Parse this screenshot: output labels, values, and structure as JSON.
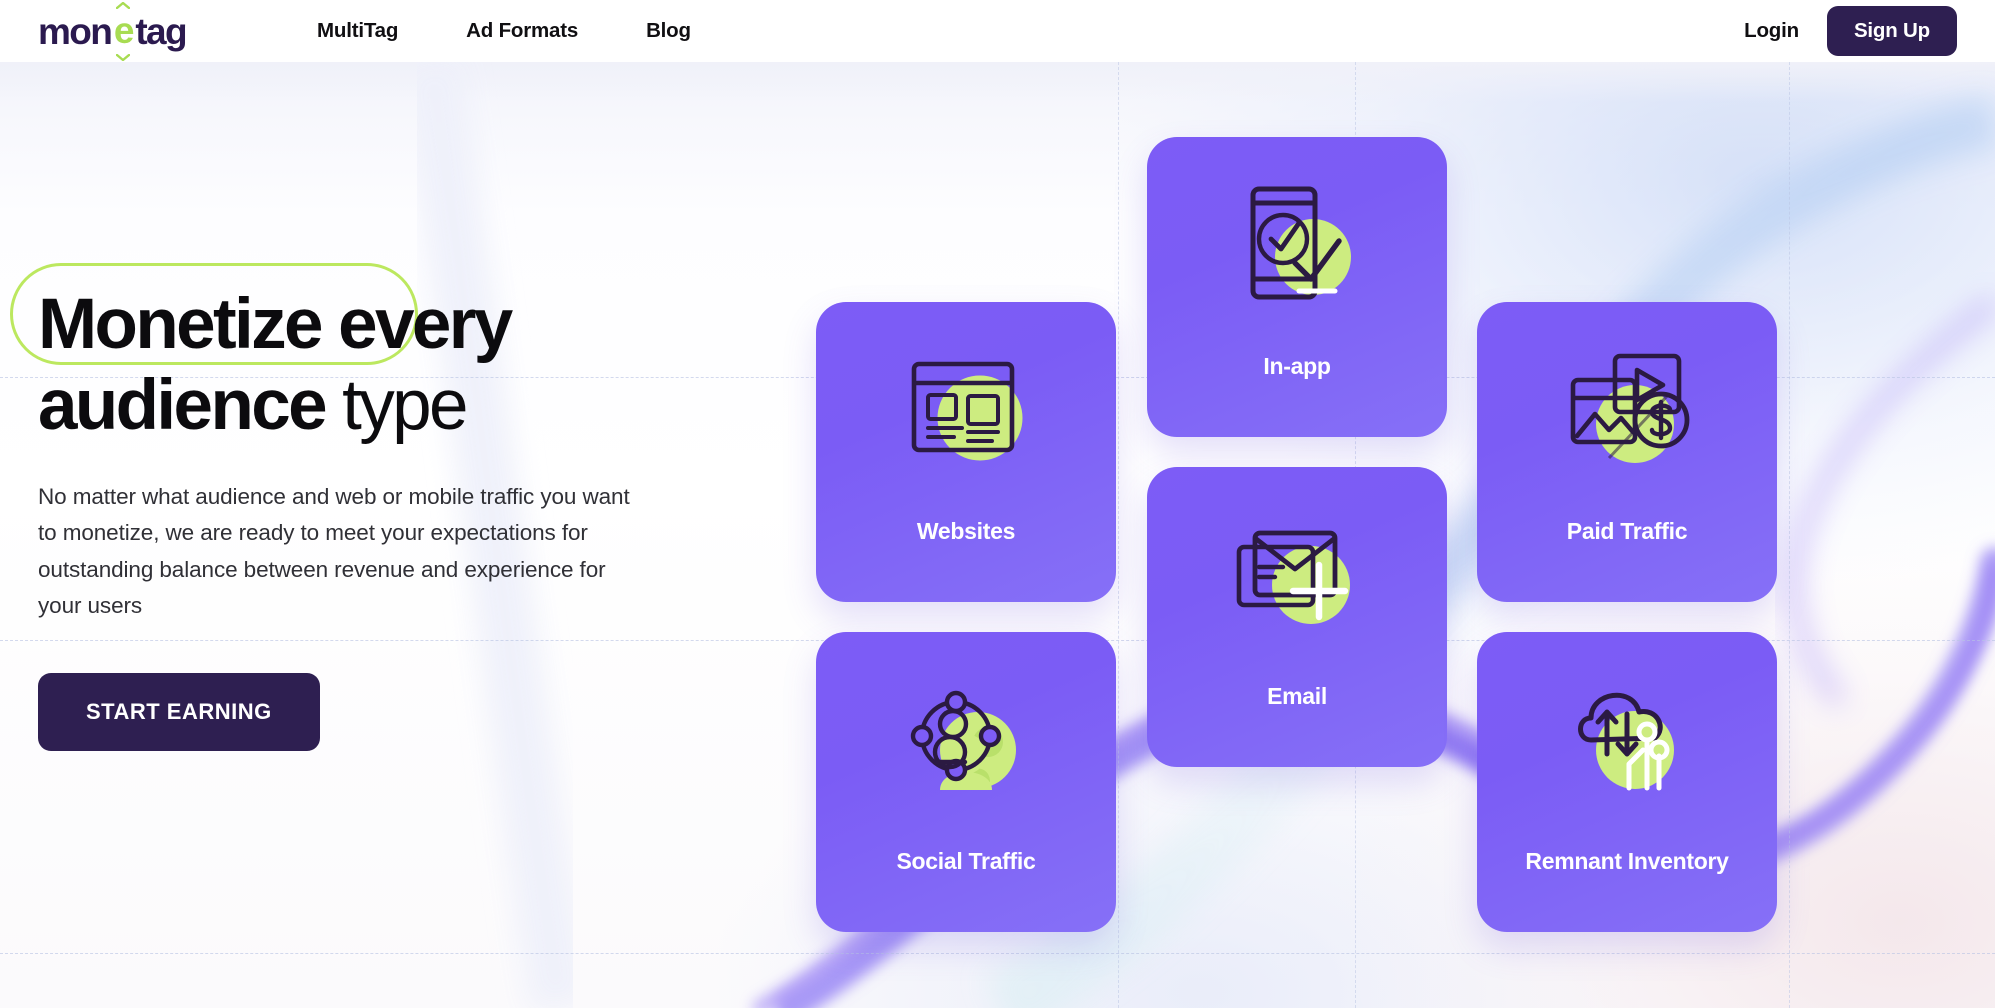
{
  "header": {
    "logo": {
      "part1": "mon",
      "accent": "e",
      "part2": "tag",
      "alt": "monetag"
    },
    "nav": [
      {
        "label": "MultiTag",
        "name": "nav-multitag"
      },
      {
        "label": "Ad Formats",
        "name": "nav-ad-formats"
      },
      {
        "label": "Blog",
        "name": "nav-blog"
      }
    ],
    "login_label": "Login",
    "signup_label": "Sign Up"
  },
  "hero": {
    "headline_1": "Monetize",
    "headline_2": " every",
    "headline_3": "audience",
    "headline_4": " type",
    "subtext": "No matter what audience and web or mobile traffic you want to monetize, we are ready to meet your expectations for outstanding balance between revenue and experience for your users",
    "cta_label": "START EARNING"
  },
  "cards": [
    {
      "id": "websites",
      "label": "Websites",
      "icon": "browser-globe-icon"
    },
    {
      "id": "inapp",
      "label": "In-app",
      "icon": "phone-check-icon"
    },
    {
      "id": "paid",
      "label": "Paid Traffic",
      "icon": "media-dollar-icon"
    },
    {
      "id": "email",
      "label": "Email",
      "icon": "envelope-plus-icon"
    },
    {
      "id": "social",
      "label": "Social Traffic",
      "icon": "network-people-icon"
    },
    {
      "id": "remnant",
      "label": "Remnant Inventory",
      "icon": "cloud-sync-icon"
    }
  ],
  "colors": {
    "brand_dark": "#2e1f51",
    "brand_purple": "#7d5cf6",
    "accent_green": "#bce85f",
    "icon_green": "#cdec80",
    "icon_dark": "#2b1a42",
    "text_dark": "#0c0b0e",
    "grid_line": "#b9c4e4"
  }
}
